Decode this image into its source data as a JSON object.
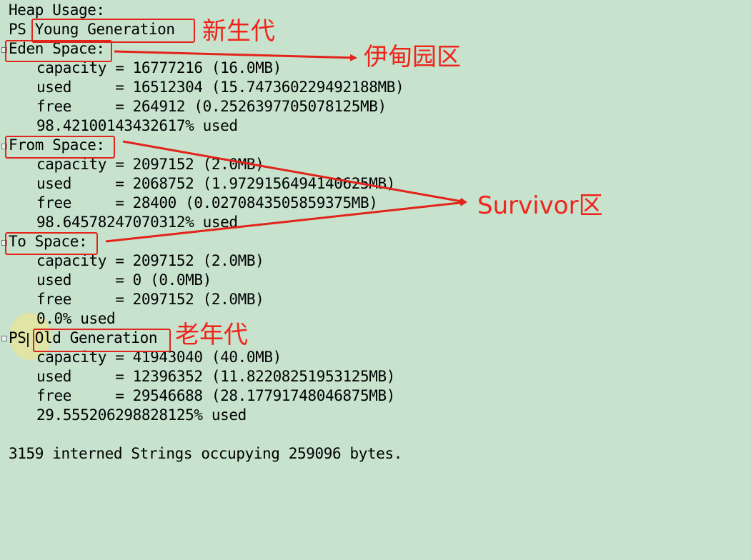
{
  "heap": {
    "title": "Heap Usage:",
    "young_prefix": "PS",
    "young_label": "Young Generation",
    "eden": {
      "header": "Eden Space:",
      "capacity": "capacity = 16777216 (16.0MB)",
      "used": "used     = 16512304 (15.747360229492188MB)",
      "free": "free     = 264912 (0.2526397705078125MB)",
      "pct": "98.42100143432617% used"
    },
    "from": {
      "header": "From Space:",
      "capacity": "capacity = 2097152 (2.0MB)",
      "used": "used     = 2068752 (1.9729156494140625MB)",
      "free": "free     = 28400 (0.0270843505859375MB)",
      "pct": "98.64578247070312% used"
    },
    "to": {
      "header": "To Space:",
      "capacity": "capacity = 2097152 (2.0MB)",
      "used": "used     = 0 (0.0MB)",
      "free": "free     = 2097152 (2.0MB)",
      "pct": "0.0% used"
    },
    "old_prefix": "PS",
    "old_label": "Old Generation",
    "old": {
      "capacity": "capacity = 41943040 (40.0MB)",
      "used": "used     = 12396352 (11.82208251953125MB)",
      "free": "free     = 29546688 (28.17791748046875MB)",
      "pct": "29.555206298828125% used"
    },
    "footer": "3159 interned Strings occupying 259096 bytes."
  },
  "annotations": {
    "young": "新生代",
    "eden": "伊甸园区",
    "survivor": "Survivor区",
    "old": "老年代"
  },
  "colors": {
    "background": "#c7e3cd",
    "annotation": "#f0241b"
  }
}
